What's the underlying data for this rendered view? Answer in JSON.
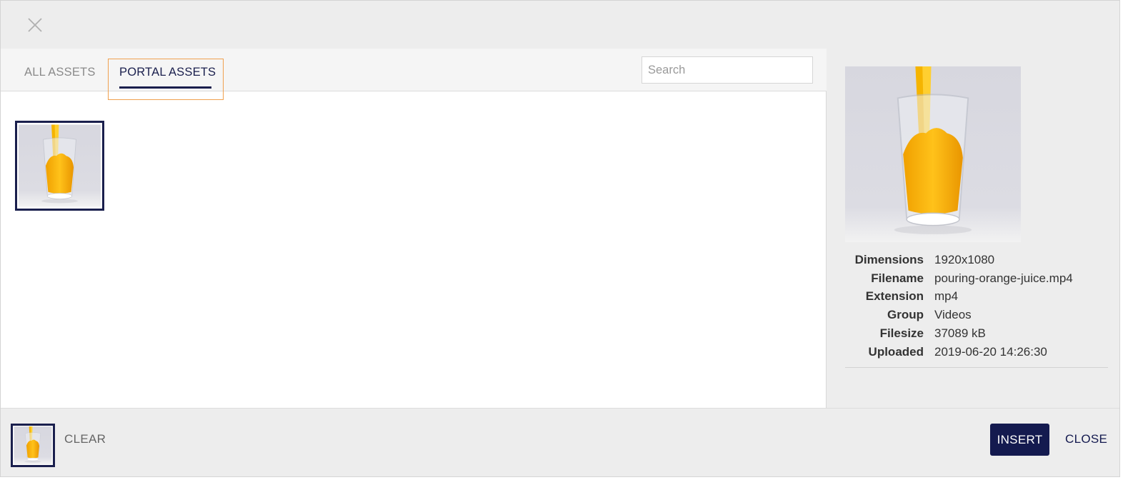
{
  "header": {
    "close_icon": "close-icon"
  },
  "tabs": [
    {
      "label": "ALL ASSETS",
      "active": false
    },
    {
      "label": "PORTAL ASSETS",
      "active": true
    }
  ],
  "search": {
    "placeholder": "Search",
    "value": ""
  },
  "assets": [
    {
      "thumbnail": "orange-juice-glass-image",
      "selected": true
    }
  ],
  "details": {
    "rows": [
      {
        "label": "Dimensions",
        "value": "1920x1080"
      },
      {
        "label": "Filename",
        "value": "pouring-orange-juice.mp4"
      },
      {
        "label": "Extension",
        "value": "mp4"
      },
      {
        "label": "Group",
        "value": "Videos"
      },
      {
        "label": "Filesize",
        "value": "37089 kB"
      },
      {
        "label": "Uploaded",
        "value": "2019-06-20 14:26:30"
      }
    ]
  },
  "footer": {
    "clear_label": "CLEAR",
    "insert_label": "INSERT",
    "close_label": "CLOSE"
  },
  "colors": {
    "accent": "#141a4f",
    "tab_focus_outline": "#f0a14f",
    "background": "#ededed"
  }
}
